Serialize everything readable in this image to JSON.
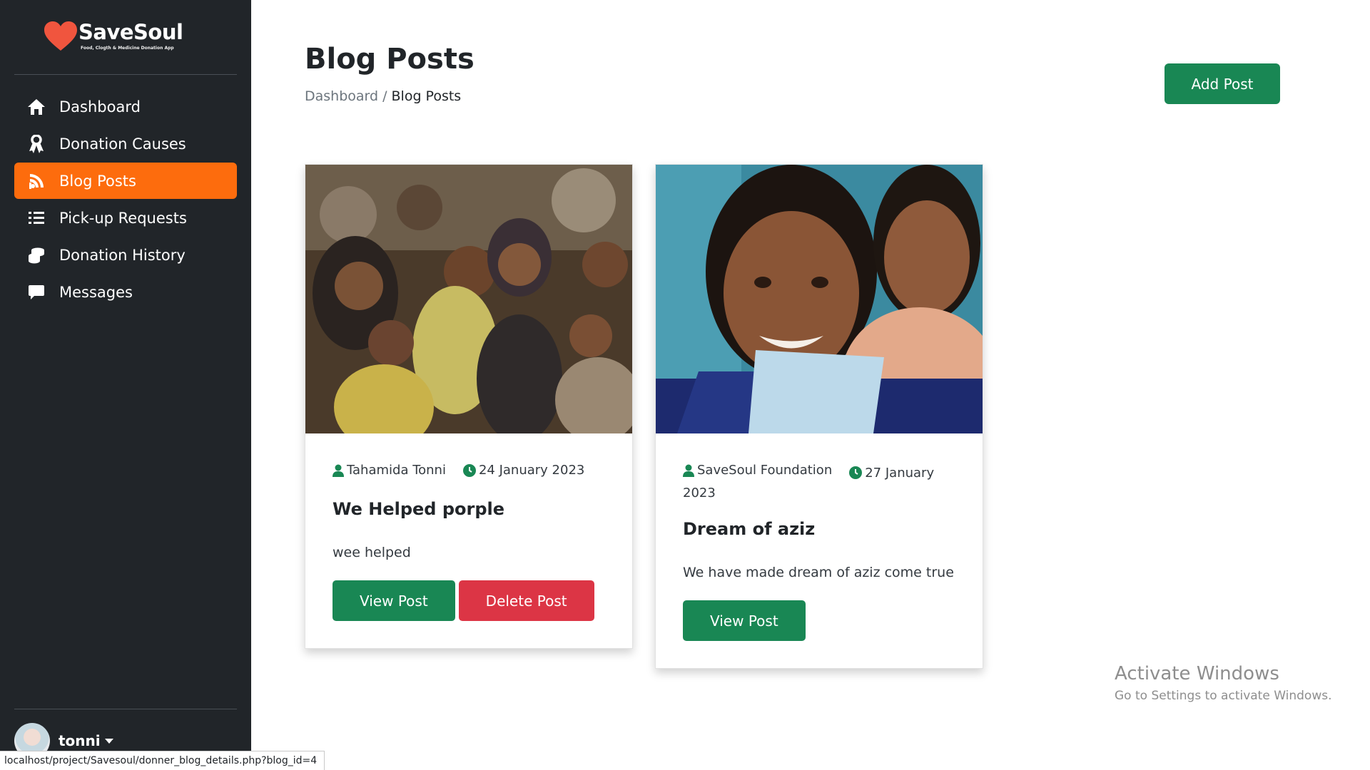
{
  "sidebar": {
    "brand": {
      "name": "SaveSoul",
      "tagline": "Food, Clogth & Medicine Donation App"
    },
    "items": [
      {
        "label": "Dashboard",
        "icon": "home-icon",
        "active": false
      },
      {
        "label": "Donation Causes",
        "icon": "ribbon-icon",
        "active": false
      },
      {
        "label": "Blog Posts",
        "icon": "blog-icon",
        "active": true
      },
      {
        "label": "Pick-up Requests",
        "icon": "list-icon",
        "active": false
      },
      {
        "label": "Donation History",
        "icon": "coins-icon",
        "active": false
      },
      {
        "label": "Messages",
        "icon": "message-icon",
        "active": false
      }
    ],
    "user": {
      "name": "tonni"
    },
    "accent": "#fd6c0d"
  },
  "header": {
    "title": "Blog Posts",
    "breadcrumb": {
      "parent": "Dashboard",
      "separator": "/",
      "current": "Blog Posts"
    },
    "add_button": "Add Post"
  },
  "posts": [
    {
      "author": "Tahamida Tonni",
      "date": "24 January 2023",
      "title": "We Helped porple",
      "excerpt": "wee helped",
      "view_label": "View Post",
      "delete_label": "Delete Post"
    },
    {
      "author": "SaveSoul Foundation",
      "date": "27 January 2023",
      "title": "Dream of aziz",
      "excerpt": "We have made dream of aziz come true",
      "view_label": "View Post"
    }
  ],
  "watermark": {
    "line1": "Activate Windows",
    "line2": "Go to Settings to activate Windows."
  },
  "status_bar_url": "localhost/project/Savesoul/donner_blog_details.php?blog_id=4",
  "colors": {
    "primary_green": "#198754",
    "danger_red": "#dc3545",
    "sidebar_bg": "#212529"
  }
}
